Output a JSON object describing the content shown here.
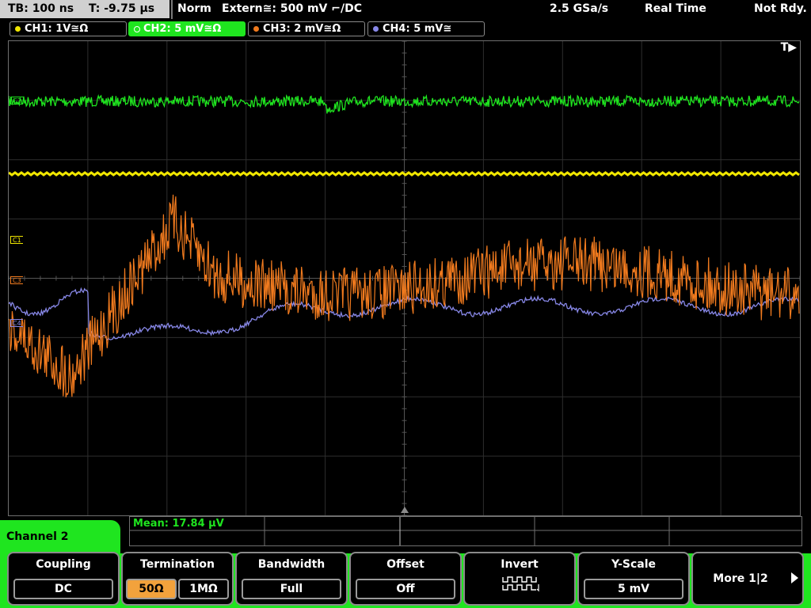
{
  "topbar": {
    "timebase": "TB: 100 ns",
    "trigger_time": "T: -9.75 µs",
    "mode": "Norm",
    "trigger_source": "Extern≅: 500 mV ⌐/DC",
    "sample_rate": "2.5 GSa/s",
    "acq_mode": "Real Time",
    "status": "Not Rdy."
  },
  "channels": [
    {
      "label": "CH1: 1V≅Ω",
      "color": "#f0e600"
    },
    {
      "label": "CH2: 5 mV≅Ω",
      "color": "#1fe51f"
    },
    {
      "label": "CH3: 2 mV≅Ω",
      "color": "#f07a1e"
    },
    {
      "label": "CH4: 5 mV≅",
      "color": "#8888e8"
    }
  ],
  "markers": {
    "trigger": "T▶",
    "c1": "C1",
    "c2": "C2",
    "c3": "C3",
    "c4": "C4"
  },
  "measurement": {
    "mean": "Mean: 17.84 µV"
  },
  "menu": {
    "channel": "Channel 2",
    "coupling": {
      "title": "Coupling",
      "value": "DC"
    },
    "termination": {
      "title": "Termination",
      "opt1": "50Ω",
      "opt2": "1MΩ",
      "selected": "50Ω"
    },
    "bandwidth": {
      "title": "Bandwidth",
      "value": "Full"
    },
    "offset": {
      "title": "Offset",
      "value": "Off"
    },
    "invert": {
      "title": "Invert",
      "icon": "invert-waveform-icon"
    },
    "yscale": {
      "title": "Y-Scale",
      "value": "5 mV"
    },
    "more": {
      "label": "More 1|2",
      "icon": "arrow-right-icon"
    }
  },
  "colors": {
    "accent": "#1fe51f",
    "selected": "#f2a23c"
  }
}
